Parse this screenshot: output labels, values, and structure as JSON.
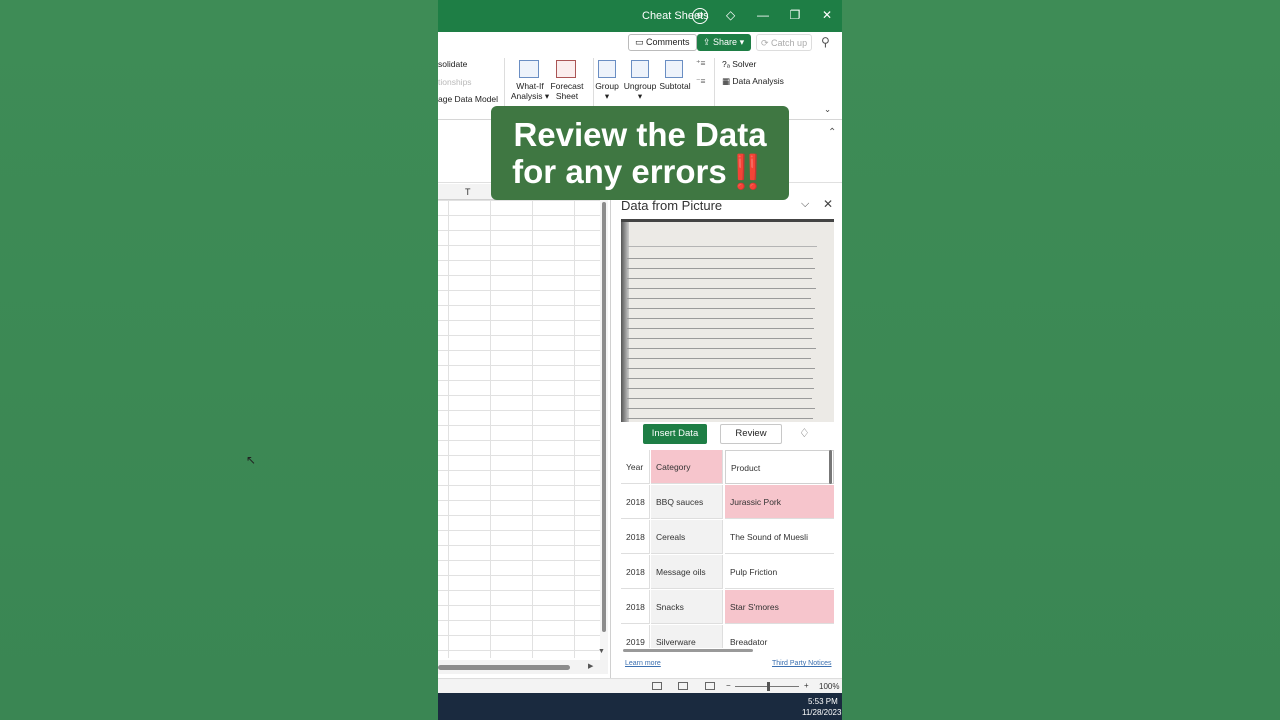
{
  "titlebar": {
    "title": "Cheat Sheets",
    "icon": "settings-circle-icon"
  },
  "ribbon_top": {
    "comments": "Comments",
    "share": "Share",
    "catchup": "Catch up"
  },
  "ribbon": {
    "consolidate": "solidate",
    "relationships": "tionships",
    "data_model": "age Data Model",
    "whatif_1": "What-If",
    "whatif_2": "Analysis",
    "forecast_1": "Forecast",
    "forecast_2": "Sheet",
    "group": "Group",
    "ungroup": "Ungroup",
    "subtotal": "Subtotal",
    "solver": "Solver",
    "data_analysis": "Data Analysis"
  },
  "column_header": "T",
  "overlay": {
    "line1": "Review the Data",
    "line2": "for any errors",
    "emoji": "‼️"
  },
  "pane": {
    "title": "Data from Picture",
    "insert": "Insert Data",
    "review": "Review",
    "learn_more": "Learn more",
    "third_party": "Third Party Notices"
  },
  "table": {
    "headers": [
      "Year",
      "Category",
      "Product"
    ],
    "rows": [
      [
        "2018",
        "BBQ sauces",
        "Jurassic Pork"
      ],
      [
        "2018",
        "Cereals",
        "The Sound of Muesli"
      ],
      [
        "2018",
        "Message oils",
        "Pulp Friction"
      ],
      [
        "2018",
        "Snacks",
        "Star S'mores"
      ],
      [
        "2019",
        "Silverware",
        "Breadator"
      ]
    ]
  },
  "status": {
    "zoom": "100%"
  },
  "taskbar": {
    "time": "5:53 PM",
    "date": "11/28/2023"
  },
  "colors": {
    "excel_green": "#1e7e45",
    "flag_pink": "#f6c5cc",
    "overlay_green": "#3f7742"
  }
}
